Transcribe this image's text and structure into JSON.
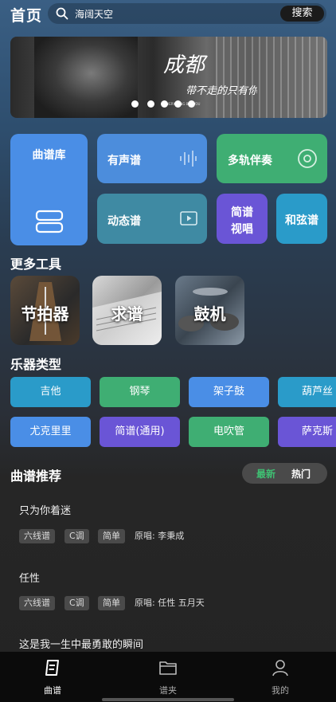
{
  "header": {
    "title": "首页",
    "search_text": "海阔天空",
    "search_button": "搜索"
  },
  "banner": {
    "headline": "成都",
    "subline": "带不走的只有你",
    "caption": "EVERYTHING BUT YOU",
    "dots": 5
  },
  "quick": {
    "library": "曲谱库",
    "audio": "有声谱",
    "multitrack": "多轨伴奏",
    "motion": "动态谱",
    "jianpu_line1": "简谱",
    "jianpu_line2": "视唱",
    "chord": "和弦谱"
  },
  "tools": {
    "title": "更多工具",
    "items": [
      {
        "label": "节拍器"
      },
      {
        "label": "求谱"
      },
      {
        "label": "鼓机"
      }
    ]
  },
  "instruments": {
    "title": "乐器类型",
    "row1": [
      "吉他",
      "钢琴",
      "架子鼓",
      "葫芦丝"
    ],
    "row2": [
      "尤克里里",
      "简谱(通用)",
      "电吹管",
      "萨克斯"
    ]
  },
  "recommend": {
    "title": "曲谱推荐",
    "tab_latest": "最新",
    "tab_hot": "热门",
    "songs": [
      {
        "title": "只为你着迷",
        "tags": [
          "六线谱",
          "C调",
          "简单"
        ],
        "orig": "原唱: 李秉成"
      },
      {
        "title": "任性",
        "tags": [
          "六线谱",
          "C调",
          "简单"
        ],
        "orig": "原唱: 任性 五月天"
      },
      {
        "title": "这是我一生中最勇敢的瞬间"
      }
    ]
  },
  "nav": {
    "items": [
      {
        "label": "曲谱"
      },
      {
        "label": "谱夹"
      },
      {
        "label": "我的"
      }
    ]
  },
  "colors": {
    "blue": "#4a8ee6",
    "green": "#3fae73",
    "cyan": "#2a9bc9",
    "purple": "#6a55d6",
    "accent_green": "#3fbf72"
  }
}
